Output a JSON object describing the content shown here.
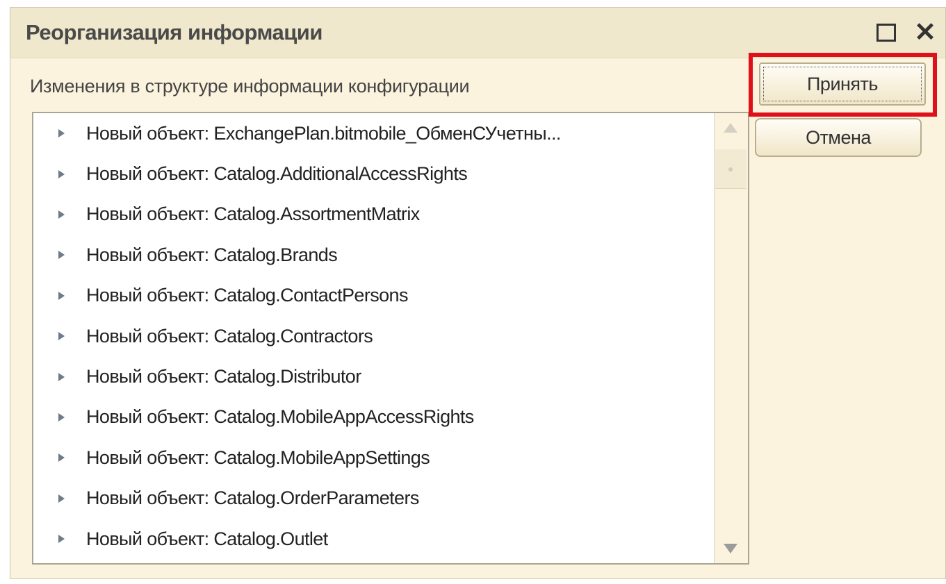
{
  "window": {
    "title": "Реорганизация информации"
  },
  "subtitle": "Изменения в структуре информации конфигурации",
  "list": {
    "items": [
      {
        "label": "Новый объект: ExchangePlan.bitmobile_ОбменСУчетны..."
      },
      {
        "label": "Новый объект: Catalog.AdditionalAccessRights"
      },
      {
        "label": "Новый объект: Catalog.AssortmentMatrix"
      },
      {
        "label": "Новый объект: Catalog.Brands"
      },
      {
        "label": "Новый объект: Catalog.ContactPersons"
      },
      {
        "label": "Новый объект: Catalog.Contractors"
      },
      {
        "label": "Новый объект: Catalog.Distributor"
      },
      {
        "label": "Новый объект: Catalog.MobileAppAccessRights"
      },
      {
        "label": "Новый объект: Catalog.MobileAppSettings"
      },
      {
        "label": "Новый объект: Catalog.OrderParameters"
      },
      {
        "label": "Новый объект: Catalog.Outlet"
      }
    ]
  },
  "buttons": {
    "accept_label": "Принять",
    "cancel_label": "Отмена"
  },
  "colors": {
    "window_bg": "#fbf3dd",
    "highlight": "#e0101a"
  },
  "icons": {
    "maximize": "maximize-icon",
    "close": "close-icon",
    "expand": "triangle-right-icon"
  }
}
